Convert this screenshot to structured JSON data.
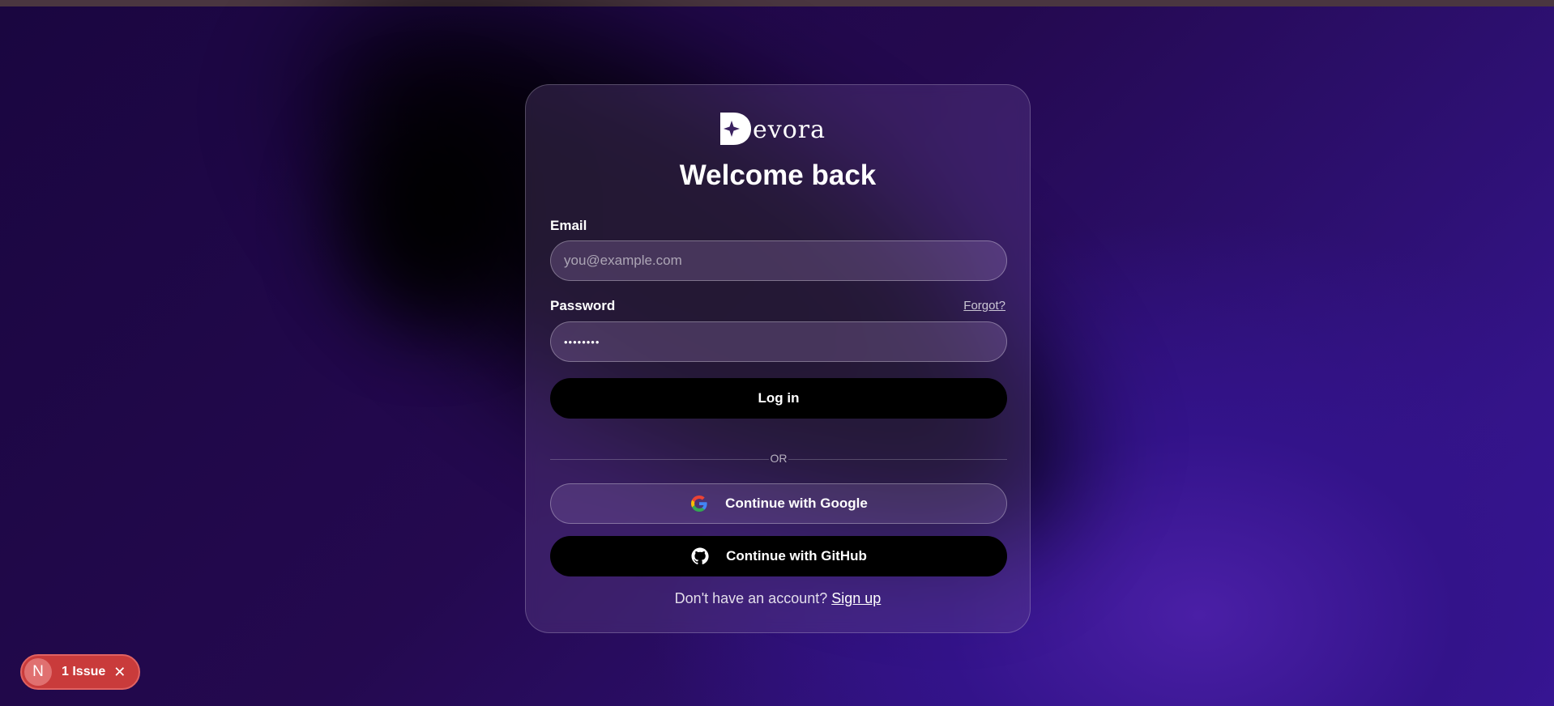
{
  "brand": {
    "logo_text": "evora"
  },
  "login": {
    "title": "Welcome back",
    "email_label": "Email",
    "email_placeholder": "you@example.com",
    "password_label": "Password",
    "password_value": "••••••••",
    "forgot_label": "Forgot?",
    "login_button": "Log in",
    "divider_text": "OR",
    "google_button": "Continue with Google",
    "github_button": "Continue with GitHub",
    "signup_prompt": "Don't have an account?",
    "signup_link": "Sign up"
  },
  "dev_overlay": {
    "badge_letter": "N",
    "issue_text": "1 Issue",
    "close_icon": "close-icon"
  },
  "icons": [
    "google-icon",
    "github-icon",
    "devora-logo-mark"
  ],
  "colors": {
    "login_button": "#000000",
    "issue_badge": "#c93b3b",
    "background_accent": "#4a1fa6"
  }
}
